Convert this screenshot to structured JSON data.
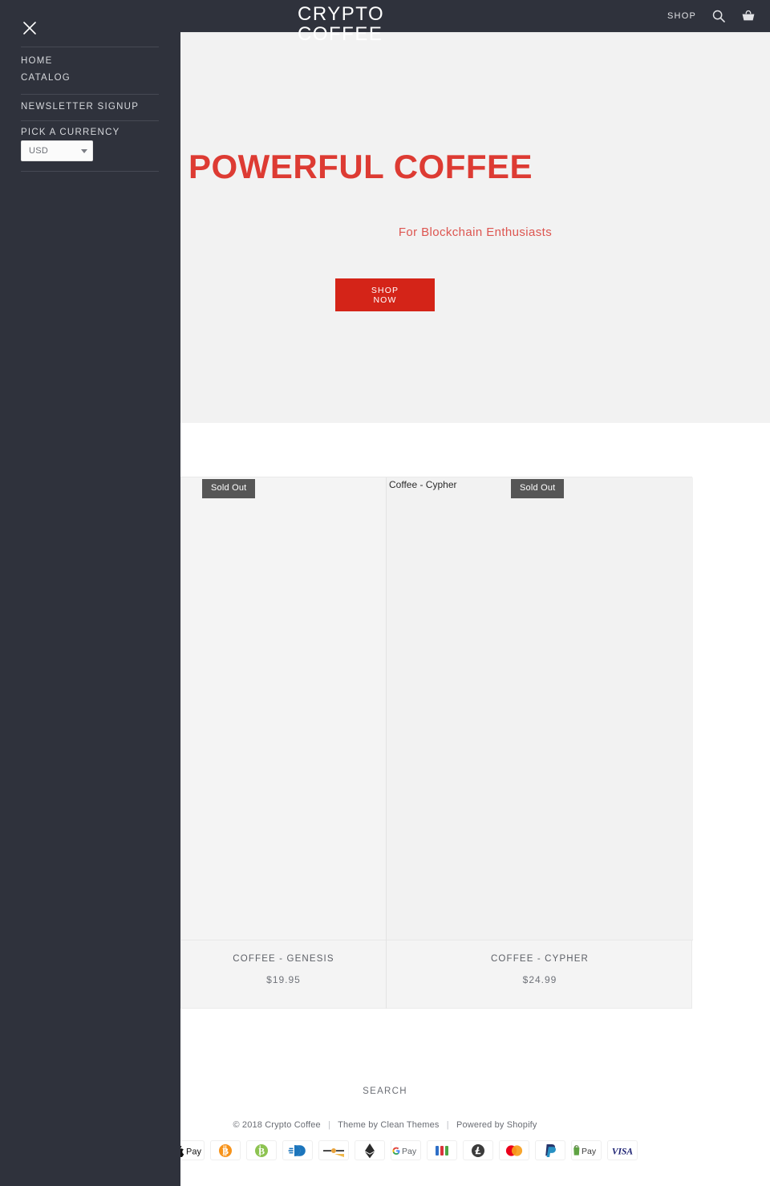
{
  "header": {
    "brand": "CRYPTO\nCOFFEE",
    "shop_label": "SHOP",
    "search_icon": "search-icon",
    "cart_icon": "shopping-basket-icon"
  },
  "sidebar": {
    "close_icon": "close-icon",
    "items": [
      {
        "label": "HOME"
      },
      {
        "label": "CATALOG"
      },
      {
        "label": "NEWSLETTER SIGNUP"
      }
    ],
    "currency": {
      "heading": "PICK A CURRENCY",
      "selected": "USD",
      "caret_icon": "chevron-down-icon"
    }
  },
  "hero": {
    "title": "POWERFUL COFFEE",
    "subtitle": "For Blockchain Enthusiasts",
    "cta": "SHOP\nNOW",
    "accent_color": "#dd3b33",
    "button_color": "#d42418"
  },
  "products": [
    {
      "title": "COFFEE - GENESIS",
      "price": "$19.95",
      "badge": "Sold Out",
      "alt_text": ""
    },
    {
      "title": "COFFEE - CYPHER",
      "price": "$24.99",
      "badge": "Sold Out",
      "alt_text": "Coffee - Cypher"
    }
  ],
  "footer": {
    "search_label": "SEARCH",
    "copyright": "© 2018 Crypto Coffee",
    "theme_credit": "Theme by Clean Themes",
    "platform_credit": "Powered by Shopify",
    "separator": "|",
    "payment_methods": [
      {
        "name": "apple-pay-icon",
        "label": "Apple Pay"
      },
      {
        "name": "bitcoin-icon",
        "label": "Bitcoin"
      },
      {
        "name": "bitcoin-cash-icon",
        "label": "Bitcoin Cash"
      },
      {
        "name": "dash-icon",
        "label": "Dash"
      },
      {
        "name": "dogecoin-icon",
        "label": "Dogecoin"
      },
      {
        "name": "ethereum-icon",
        "label": "Ethereum"
      },
      {
        "name": "google-pay-icon",
        "label": "G Pay"
      },
      {
        "name": "jcb-icon",
        "label": "JCB"
      },
      {
        "name": "litecoin-icon",
        "label": "Litecoin"
      },
      {
        "name": "mastercard-icon",
        "label": "Mastercard"
      },
      {
        "name": "paypal-icon",
        "label": "PayPal"
      },
      {
        "name": "shop-pay-icon",
        "label": "Shop Pay"
      },
      {
        "name": "visa-icon",
        "label": "VISA"
      }
    ]
  }
}
